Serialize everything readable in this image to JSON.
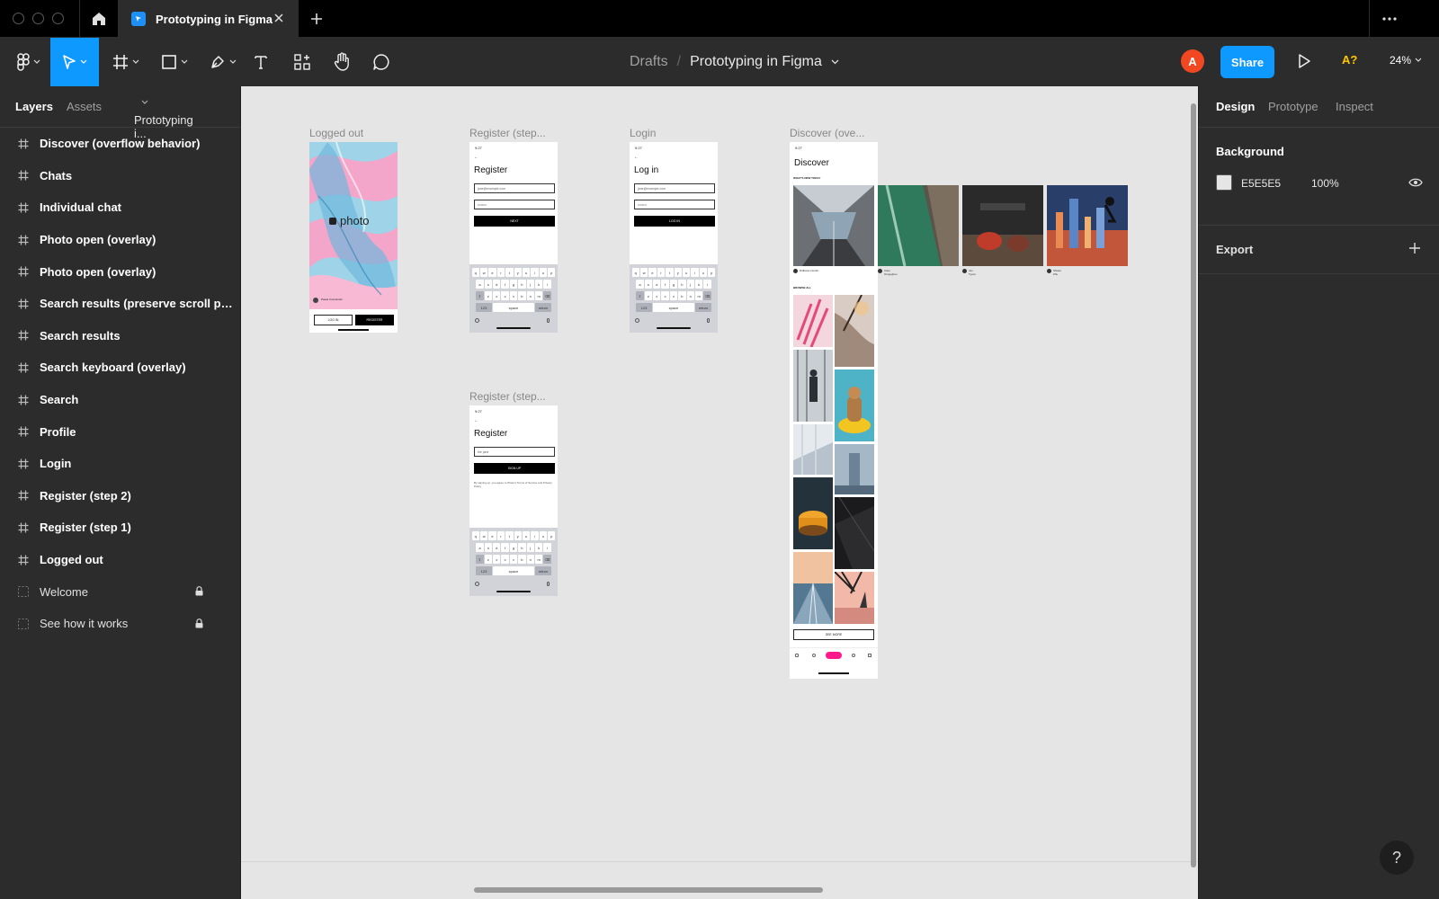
{
  "window": {
    "tabs": [
      {
        "label": "Prototyping in Figma"
      }
    ]
  },
  "toolbar": {
    "breadcrumb_parent": "Drafts",
    "breadcrumb_separator": "/",
    "file_name": "Prototyping in Figma",
    "avatar_initial": "A",
    "share_label": "Share",
    "font_warning": "A?",
    "zoom": "24%"
  },
  "left_panel": {
    "tabs": {
      "layers": "Layers",
      "assets": "Assets"
    },
    "page_name": "Prototyping i...",
    "layers": [
      {
        "label": "Discover (overflow behavior)",
        "type": "frame"
      },
      {
        "label": "Chats",
        "type": "frame"
      },
      {
        "label": "Individual chat",
        "type": "frame"
      },
      {
        "label": "Photo open (overlay)",
        "type": "frame"
      },
      {
        "label": "Photo open (overlay)",
        "type": "frame"
      },
      {
        "label": "Search results (preserve scroll po...",
        "type": "frame"
      },
      {
        "label": "Search results",
        "type": "frame"
      },
      {
        "label": "Search keyboard (overlay)",
        "type": "frame"
      },
      {
        "label": "Search",
        "type": "frame"
      },
      {
        "label": "Profile",
        "type": "frame"
      },
      {
        "label": "Login",
        "type": "frame"
      },
      {
        "label": "Register (step 2)",
        "type": "frame"
      },
      {
        "label": "Register (step 1)",
        "type": "frame"
      },
      {
        "label": "Logged out",
        "type": "frame"
      },
      {
        "label": "Welcome",
        "type": "section",
        "locked": true
      },
      {
        "label": "See how it works",
        "type": "section",
        "locked": true
      }
    ]
  },
  "canvas": {
    "frames": {
      "logged_out": {
        "title": "Logged out",
        "brand": "photo",
        "login_btn": "LOG IN",
        "register_btn": "REGISTER",
        "credit": "Pawel Czerwinski"
      },
      "register1": {
        "title": "Register (step...",
        "status": "9:27",
        "heading": "Register",
        "email": "jane@example.com",
        "password": "••••••••",
        "button": "NEXT"
      },
      "login": {
        "title": "Login",
        "status": "9:27",
        "heading": "Log in",
        "email": "jane@example.com",
        "password": "••••••••",
        "button": "LOG IN"
      },
      "register2": {
        "title": "Register (step...",
        "status": "9:27",
        "heading": "Register",
        "name": "the jane",
        "button": "SIGN UP",
        "terms": "By signing up, you agree to Photo's Terms of Service and Privacy Policy"
      },
      "discover": {
        "title": "Discover (ove...",
        "status": "9:27",
        "heading": "Discover",
        "section1": "WHAT'S NEW TODAY",
        "section2": "BROWSE ALL",
        "see_more": "SEE MORE",
        "authors": [
          {
            "name": "Ridhwan Nordin",
            "handle": "@ridzjcob"
          },
          {
            "name": "Clem Onojeghuo",
            "handle": "@clemono"
          },
          {
            "name": "Jon Tyson",
            "handle": "@jontyson"
          },
          {
            "name": "Shiwei Zhu",
            "handle": "@shiweiz"
          }
        ]
      }
    },
    "keyboard": {
      "row1": [
        "q",
        "w",
        "e",
        "r",
        "t",
        "y",
        "u",
        "i",
        "o",
        "p"
      ],
      "row2": [
        "a",
        "s",
        "d",
        "f",
        "g",
        "h",
        "j",
        "k",
        "l"
      ],
      "row3": [
        "z",
        "x",
        "c",
        "v",
        "b",
        "n",
        "m"
      ],
      "num": "123",
      "space": "space",
      "return": "return"
    }
  },
  "right_panel": {
    "tabs": {
      "design": "Design",
      "prototype": "Prototype",
      "inspect": "Inspect"
    },
    "background_title": "Background",
    "background_hex": "E5E5E5",
    "background_opacity": "100%",
    "export_title": "Export"
  },
  "help_label": "?",
  "colors": {
    "accent": "#0d99ff",
    "avatar": "#f24822",
    "canvas": "#e5e5e5",
    "warning": "#ffc700"
  }
}
